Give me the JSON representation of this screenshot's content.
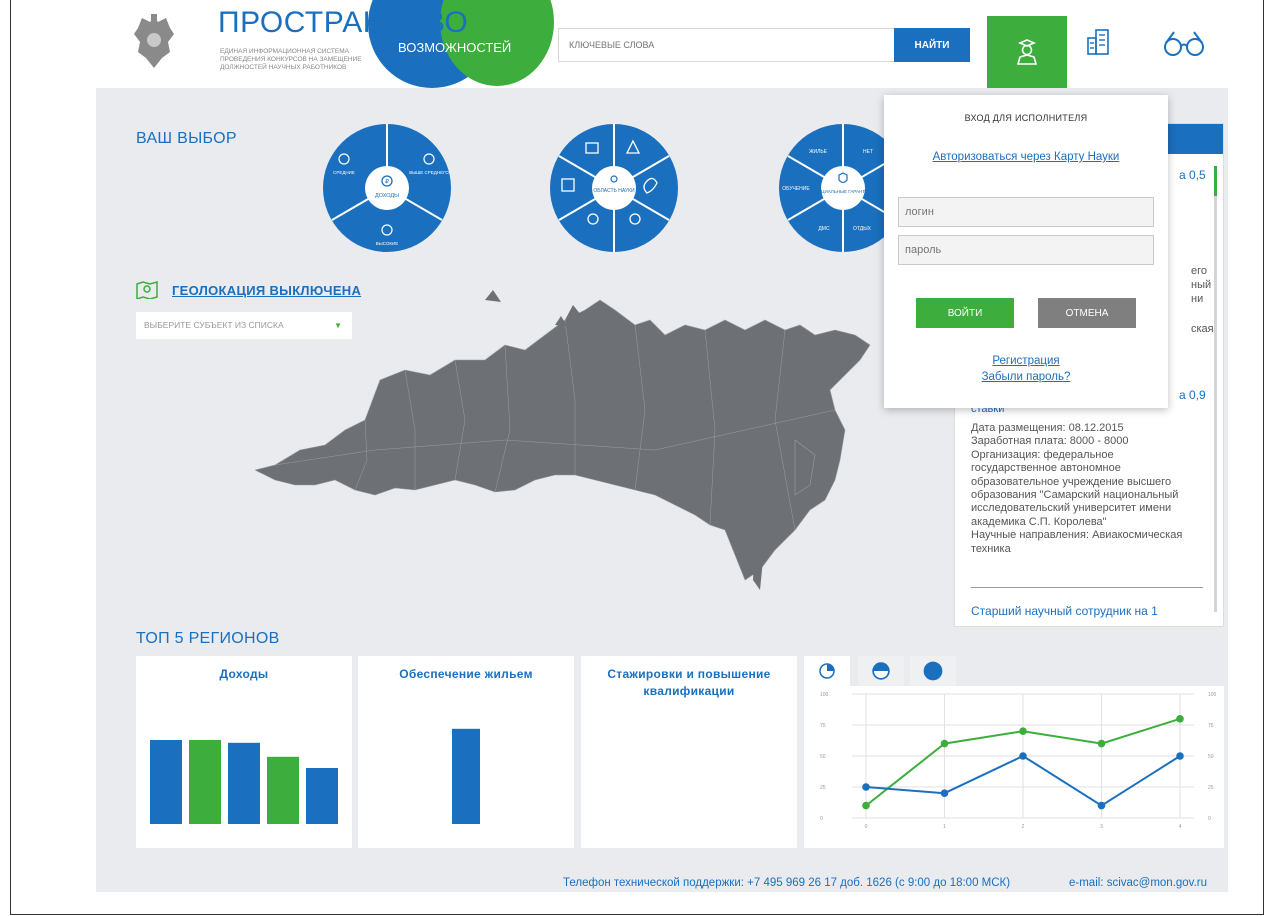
{
  "header": {
    "logo_title": "ПРОСТРАНСТВО",
    "logo_word2": "ВОЗМОЖНОСТЕЙ",
    "logo_subtitle": "ЕДИНАЯ ИНФОРМАЦИОННАЯ СИСТЕМА ПРОВЕДЕНИЯ КОНКУРСОВ НА ЗАМЕЩЕНИЕ ДОЛЖНОСТЕЙ НАУЧНЫХ РАБОТНИКОВ",
    "search_placeholder": "КЛЮЧЕВЫЕ СЛОВА",
    "search_button": "НАЙТИ",
    "icons": [
      "user-icon",
      "building-icon",
      "glasses-icon"
    ]
  },
  "choice": {
    "title": "ВАШ ВЫБОР",
    "wheel1": {
      "center": "ДОХОДЫ",
      "segments": [
        "СРЕДНИЕ",
        "ВЫШЕ СРЕДНЕГО",
        "ВЫСОКИЕ"
      ]
    },
    "wheel2": {
      "center": "ОБЛАСТЬ НАУКИ"
    },
    "wheel3": {
      "center": "СОЦИАЛЬНЫЕ ГАРАНТИИ",
      "segments": [
        "ЖИЛЬЕ",
        "НЕТ",
        "ОБУЧЕНИЕ",
        "ДМС",
        "ОТДЫХ",
        "ПР"
      ]
    }
  },
  "geo": {
    "link": "ГЕОЛОКАЦИЯ ВЫКЛЮЧЕНА",
    "select_placeholder": "ВЫБЕРИТЕ СУБЪЕКТ ИЗ СПИСКА"
  },
  "login": {
    "title": "ВХОД ДЛЯ ИСПОЛНИТЕЛЯ",
    "karta_link": "Авторизоваться через Карту Науки",
    "login_placeholder": "логин",
    "password_placeholder": "пароль",
    "submit": "ВОЙТИ",
    "cancel": "ОТМЕНА",
    "register": "Регистрация",
    "forgot": "Забыли пароль?"
  },
  "vacancies": {
    "partial_right_1": "а 0,5",
    "partial_lines": [
      "его",
      "ный",
      "ни",
      "ская"
    ],
    "partial_right_2": "а 0,9",
    "partial_stavki": "ставки",
    "details": [
      "Дата размещения: 08.12.2015",
      "Заработная плата: 8000 - 8000",
      "Организация: федеральное",
      "государственное автономное",
      "образовательное учреждение высшего",
      "образования \"Самарский национальный",
      "исследовательский университет имени",
      "академика С.П. Королева\"",
      "Научные направления: Авиакосмическая",
      "техника"
    ],
    "next_item": "Старший научный сотрудник на 1"
  },
  "top5": {
    "title": "ТОП 5 РЕГИОНОВ",
    "cards": [
      "Доходы",
      "Обеспечение жильем",
      "Стажировки и повышение квалификации"
    ]
  },
  "colors": {
    "blue": "#1a6fbe",
    "green": "#3dae3d"
  },
  "chart_data": [
    {
      "type": "bar",
      "title": "Доходы",
      "values": [
        60,
        60,
        58,
        48,
        40
      ],
      "colors": [
        "#1a6fbe",
        "#3dae3d",
        "#1a6fbe",
        "#3dae3d",
        "#1a6fbe"
      ],
      "ylim": [
        0,
        100
      ]
    },
    {
      "type": "bar",
      "title": "Обеспечение жильем",
      "values": [
        68
      ],
      "colors": [
        "#1a6fbe"
      ],
      "ylim": [
        0,
        100
      ]
    },
    {
      "type": "line",
      "x": [
        0,
        1,
        2,
        3,
        4
      ],
      "yticks_left": [
        "0",
        "25",
        "50",
        "75",
        "100"
      ],
      "yticks_right": [
        "0",
        "25",
        "50",
        "75",
        "100"
      ],
      "ylim": [
        0,
        100
      ],
      "series": [
        {
          "values": [
            10,
            60,
            70,
            60,
            80
          ],
          "color": "#3dae3d"
        },
        {
          "values": [
            25,
            20,
            50,
            10,
            50
          ],
          "color": "#1a6fbe"
        }
      ]
    }
  ],
  "footer": {
    "phone": "Телефон технической поддержки: +7 495 969 26 17 доб. 1626 (с 9:00 до 18:00 МСК)",
    "email": "e-mail: scivac@mon.gov.ru"
  }
}
